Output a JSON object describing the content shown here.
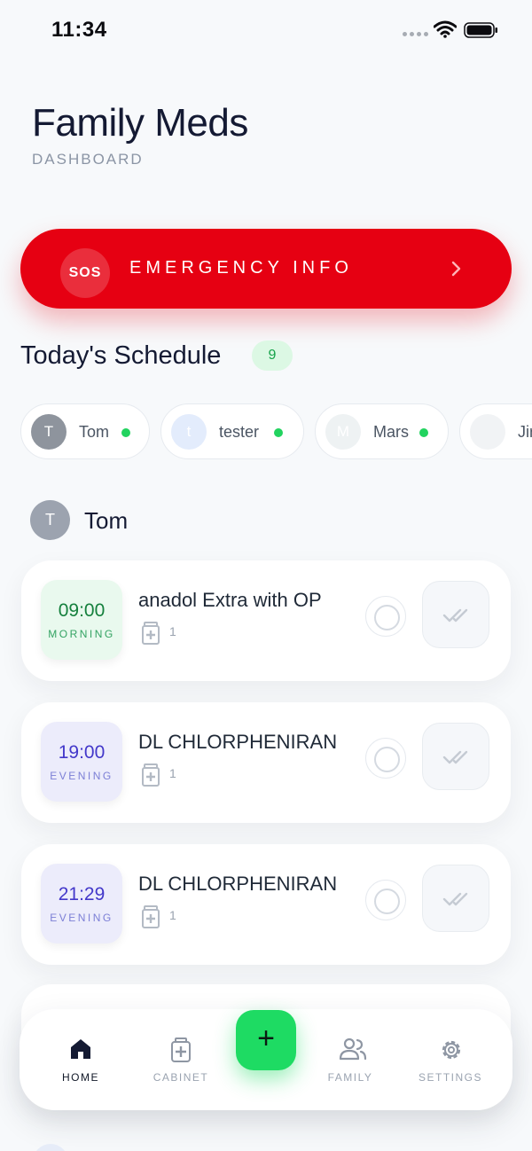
{
  "status_bar": {
    "time": "11:34"
  },
  "header": {
    "title": "Family Meds",
    "subtitle": "DASHBOARD"
  },
  "emergency": {
    "badge": "SOS",
    "label": "EMERGENCY INFO"
  },
  "schedule": {
    "title": "Today's Schedule",
    "count": "9",
    "members": [
      {
        "initial": "T",
        "name": "Tom"
      },
      {
        "initial": "t",
        "name": "tester"
      },
      {
        "initial": "M",
        "name": "Mars"
      },
      {
        "initial": "",
        "name": "Jir"
      }
    ],
    "section": {
      "initial": "T",
      "name": "Tom",
      "doses": [
        {
          "time": "09:00",
          "period": "MORNING",
          "med": "anadol Extra with OP",
          "qty": "1"
        },
        {
          "time": "19:00",
          "period": "EVENING",
          "med": "DL CHLORPHENIRAN",
          "qty": "1"
        },
        {
          "time": "21:29",
          "period": "EVENING",
          "med": "DL CHLORPHENIRAN",
          "qty": "1"
        }
      ]
    }
  },
  "nav": {
    "home": "HOME",
    "cabinet": "CABINET",
    "add": "+",
    "family": "FAMILY",
    "settings": "SETTINGS"
  },
  "colors": {
    "emergency": "#e60012",
    "accent_green": "#1edb63",
    "online": "#22d35f",
    "evening": "#4338ca",
    "morning": "#15803d"
  },
  "icons": {
    "status": [
      "wifi-icon",
      "battery-icon"
    ],
    "emergency": "chevron-right-icon",
    "dose": [
      "pill-bottle-icon",
      "double-check-icon"
    ],
    "nav": [
      "home-icon",
      "cabinet-icon",
      "plus-icon",
      "family-icon",
      "gear-icon"
    ]
  }
}
